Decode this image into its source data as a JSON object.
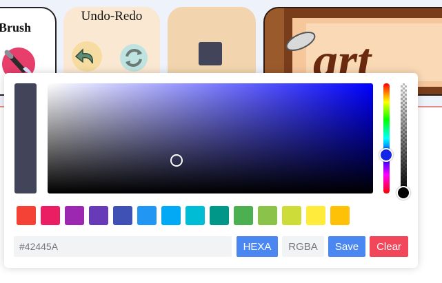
{
  "toolbar": {
    "brush": {
      "title": "Brush",
      "icon": "brush-icon"
    },
    "undo_redo": {
      "title": "Undo-Redo",
      "undo_icon": "undo-icon",
      "redo_icon": "redo-icon"
    },
    "color": {
      "current_color": "#42445A"
    },
    "art": {
      "text": "art",
      "icon": "art-banner-icon"
    },
    "accent_line_color": "#e58a85"
  },
  "picker": {
    "current_color": "#42445A",
    "hue_color": "#0000ff",
    "swatches": [
      "#f44336",
      "#e91e63",
      "#9c27b0",
      "#673ab7",
      "#3f51b5",
      "#2196f3",
      "#03a9f4",
      "#00bcd4",
      "#009688",
      "#4caf50",
      "#8bc34a",
      "#cddc39",
      "#ffeb3b",
      "#ffc107"
    ],
    "hex_value": "#42445A",
    "buttons": {
      "hexa": "HEXA",
      "rgba": "RGBA",
      "save": "Save",
      "clear": "Clear"
    }
  }
}
